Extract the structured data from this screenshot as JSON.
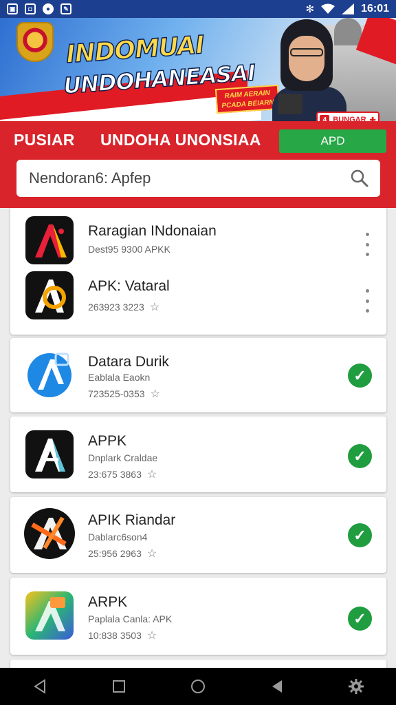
{
  "status_bar": {
    "time": "16:01",
    "left_icons": [
      "image-icon",
      "box-icon",
      "media-icon",
      "edit-icon"
    ],
    "right_icons": [
      "bluetooth-icon",
      "wifi-icon",
      "signal-icon"
    ]
  },
  "banner": {
    "title": "INDOMUAI",
    "subtitle": "UNDOHANEASAI",
    "promo_tag": "RAIM AERAIN PCADA BEIARN",
    "badge": "BUNGAR",
    "badge_icon": "4"
  },
  "header": {
    "nav_items": [
      "PUSIAR",
      "UNDOHA UNONSIAA"
    ],
    "action_button": "APD"
  },
  "search": {
    "placeholder": "Nendoran6: Apfep"
  },
  "apps": [
    {
      "name": "Raragian INdonaian",
      "sub": "Dest95 9300 APKK",
      "meta": "",
      "action": "more"
    },
    {
      "name": "APK: Vataral",
      "sub": "",
      "meta": "263923 3223",
      "action": "more"
    },
    {
      "name": "Datara Durik",
      "sub": "Eablala Eaokn",
      "meta": "723525-0353",
      "action": "installed"
    },
    {
      "name": "APPK",
      "sub": "Dnplark Craldae",
      "meta": "23:675 3863",
      "action": "installed"
    },
    {
      "name": "APIK Riandar",
      "sub": "Dablarc6son4",
      "meta": "25:956 2963",
      "action": "installed"
    },
    {
      "name": "ARPK",
      "sub": "Paplala Canla: APK",
      "meta": "10:838 3503",
      "action": "installed"
    }
  ],
  "colors": {
    "header_red": "#d9242b",
    "status_blue": "#1d3f8f",
    "installed_green": "#1f9d3f",
    "apd_green": "#27a745"
  },
  "navbar": [
    "back-icon",
    "recents-icon",
    "home-icon",
    "play-icon",
    "settings-icon"
  ]
}
